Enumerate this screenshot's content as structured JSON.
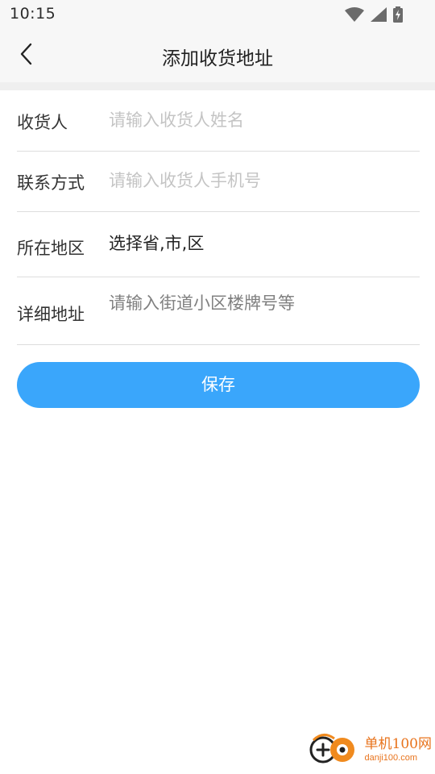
{
  "status_bar": {
    "time": "10:15",
    "icons": [
      "wifi-icon",
      "signal-icon",
      "battery-charging-icon"
    ]
  },
  "nav": {
    "back_icon": "chevron-left-icon",
    "title": "添加收货地址"
  },
  "form": {
    "receiver": {
      "label": "收货人",
      "placeholder": "请输入收货人姓名",
      "value": ""
    },
    "phone": {
      "label": "联系方式",
      "placeholder": "请输入收货人手机号",
      "value": ""
    },
    "region": {
      "label": "所在地区",
      "value": "选择省,市,区"
    },
    "address": {
      "label": "详细地址",
      "placeholder": "请输入街道小区楼牌号等",
      "value": ""
    }
  },
  "save_label": "保存",
  "watermark": {
    "brand_cn": "单机100网",
    "brand_en": "danji100.com"
  },
  "colors": {
    "accent": "#3aa6fb",
    "background": "#ffffff",
    "nav_background": "#f7f7f7",
    "placeholder": "#c4c4c4",
    "watermark": "#e8731c"
  }
}
